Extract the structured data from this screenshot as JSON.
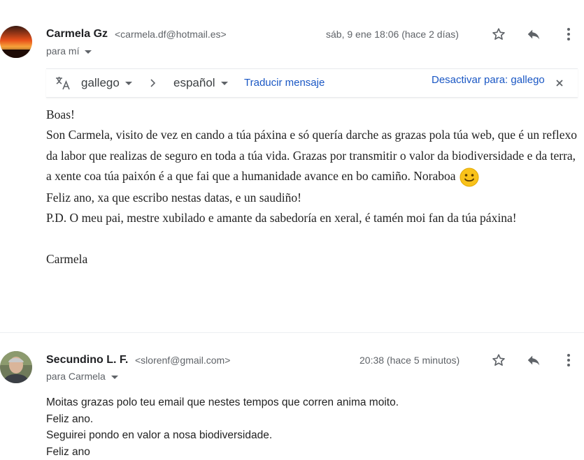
{
  "message1": {
    "sender_name": "Carmela Gz",
    "sender_email": "<carmela.df@hotmail.es>",
    "date": "sáb, 9 ene 18:06 (hace 2 días)",
    "to": "para mí",
    "translate": {
      "source_lang": "gallego",
      "target_lang": "español",
      "translate_link": "Traducir mensaje",
      "disable_link": "Desactivar para: gallego"
    },
    "body": [
      "Boas!",
      "Son Carmela, visito de vez en cando a túa páxina e só quería darche as grazas pola túa web, que é un reflexo da labor que realizas de seguro en toda a túa vida. Grazas por transmitir o valor da biodiversidade e da terra, a xente coa túa paixón é a que fai que a humanidade avance en bo camiño. Noraboa",
      "Feliz ano, xa que escribo nestas datas, e un saudiño!",
      "P.D. O meu pai, mestre xubilado e amante da sabedoría en xeral, é tamén moi fan da túa páxina!",
      "",
      "Carmela"
    ]
  },
  "message2": {
    "sender_name": "Secundino L. F.",
    "sender_email": "<slorenf@gmail.com>",
    "date": "20:38 (hace 5 minutos)",
    "to": "para Carmela",
    "body": [
      "Moitas grazas polo teu email que nestes tempos que corren anima moito.",
      "Feliz ano.",
      "Seguirei pondo en valor a nosa biodiversidade.",
      "Feliz ano"
    ]
  },
  "icons": [
    "star-icon",
    "reply-icon",
    "more-vert-icon",
    "translate-icon",
    "chevron-right-icon",
    "close-icon",
    "smile-emoji"
  ],
  "colors": {
    "link": "#1a57c4",
    "text": "#202124",
    "muted": "#5f6368"
  }
}
